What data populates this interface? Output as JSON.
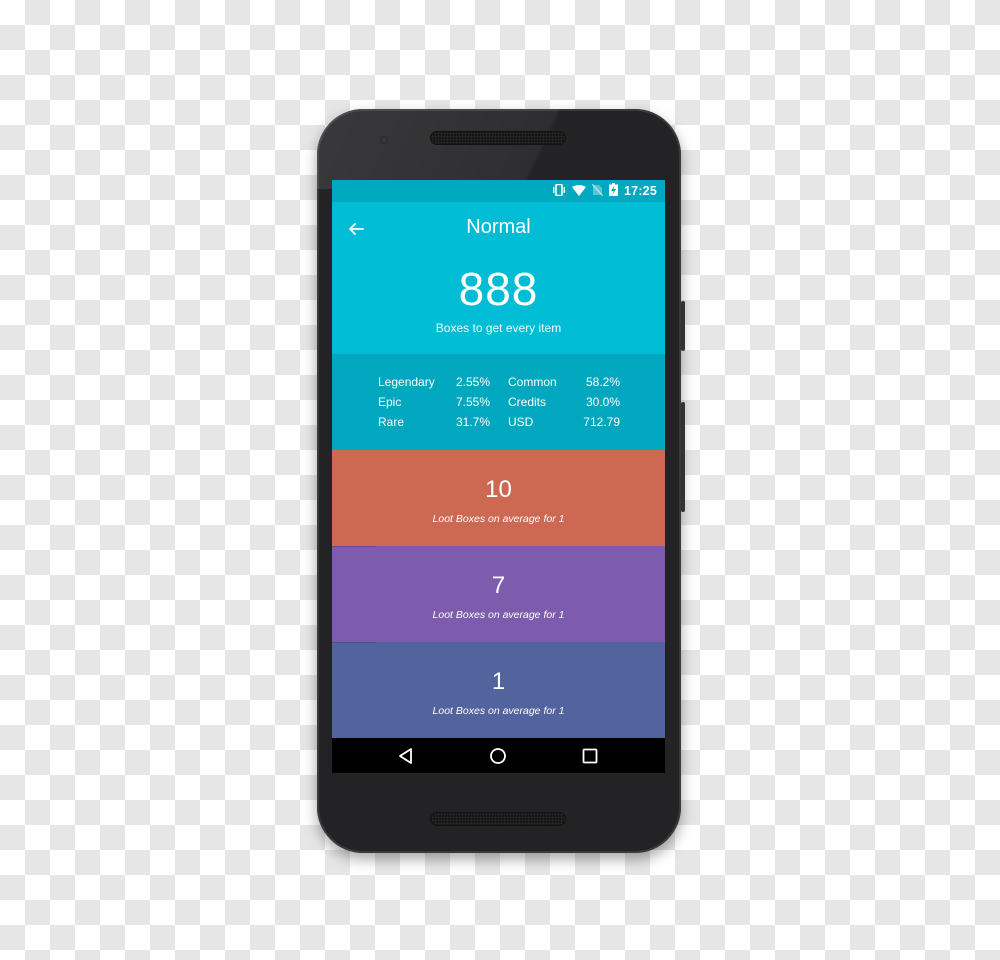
{
  "status_bar": {
    "time": "17:25",
    "icons": [
      "vibrate-icon",
      "wifi-icon",
      "no-sim-icon",
      "battery-charging-icon"
    ]
  },
  "header": {
    "back_icon": "arrow-left-icon",
    "title": "Normal",
    "big_number": "888",
    "subtitle": "Boxes to get every item"
  },
  "stats": [
    {
      "label": "Legendary",
      "value": "2.55%",
      "label2": "Common",
      "value2": "58.2%"
    },
    {
      "label": "Epic",
      "value": "7.55%",
      "label2": "Credits",
      "value2": "30.0%"
    },
    {
      "label": "Rare",
      "value": "31.7%",
      "label2": "USD",
      "value2": "712.79"
    }
  ],
  "cards": [
    {
      "value": "10",
      "caption": "Loot Boxes on average for 1",
      "color": "#cd6952"
    },
    {
      "value": "7",
      "caption": "Loot Boxes on average for 1",
      "color": "#7d5cae"
    },
    {
      "value": "1",
      "caption": "Loot Boxes on average for 1",
      "color": "#52639e"
    }
  ],
  "nav_bar": {
    "buttons": [
      "back-triangle-icon",
      "home-circle-icon",
      "recents-square-icon"
    ]
  },
  "colors": {
    "status_bar": "#00a8c0",
    "header": "#00bcd5",
    "stats": "#00a7be",
    "phone_body": "#232325"
  }
}
